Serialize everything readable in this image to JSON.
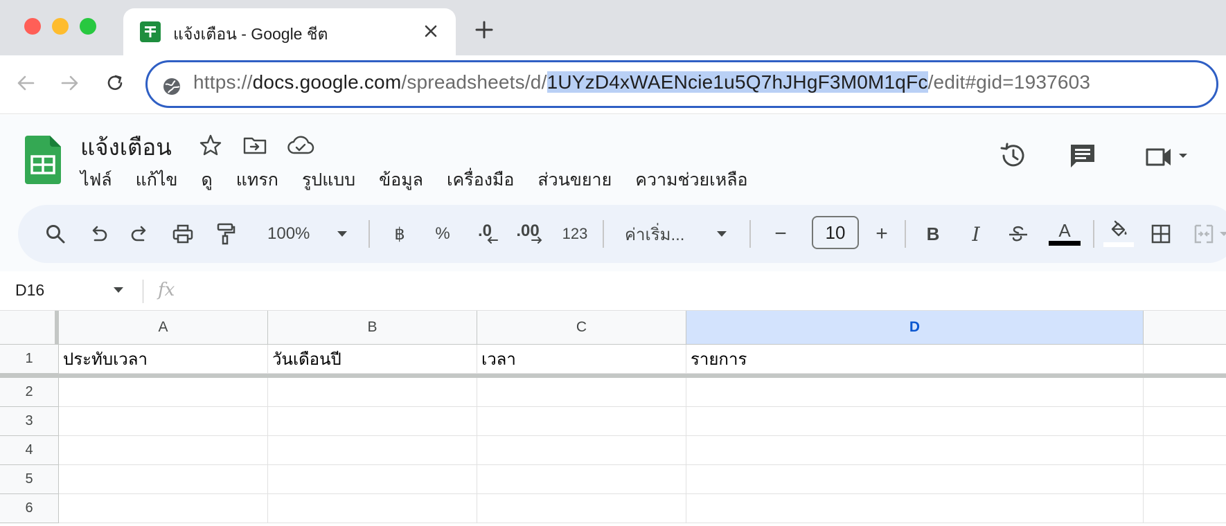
{
  "browser": {
    "tab_title": "แจ้งเตือน - Google ชีต",
    "url_scheme": "https://",
    "url_host": "docs.google.com",
    "url_path_prefix": "/spreadsheets/d/",
    "url_selected": "1UYzD4xWAENcie1u5Q7hJHgF3M0M1qFc",
    "url_path_suffix": "/edit#gid=1937603",
    "colors": {
      "traffic_red": "#ff5f57",
      "traffic_yellow": "#febc2e",
      "traffic_green": "#28c840",
      "omnibox_border": "#2f5fc4",
      "selection": "#b9d0f5"
    }
  },
  "doc": {
    "title": "แจ้งเตือน",
    "menu": [
      "ไฟล์",
      "แก้ไข",
      "ดู",
      "แทรก",
      "รูปแบบ",
      "ข้อมูล",
      "เครื่องมือ",
      "ส่วนขยาย",
      "ความช่วยเหลือ"
    ],
    "icons": {
      "star": "star-icon",
      "move": "move-to-folder-icon",
      "cloud": "cloud-saved-icon",
      "history": "history-icon",
      "comments": "comments-icon",
      "meet": "video-call-icon"
    }
  },
  "toolbar": {
    "zoom": "100%",
    "currency": "฿",
    "percent": "%",
    "decrease_decimal": ".0",
    "increase_decimal": ".00",
    "number_format": "123",
    "font": "ค่าเริ่ม...",
    "font_size": "10",
    "minus": "−",
    "plus": "+",
    "bold": "B",
    "italic": "I",
    "text_color_letter": "A",
    "text_color": "#000000",
    "fill_color": "#ffffff"
  },
  "formula_bar": {
    "cell_ref": "D16",
    "fx": "fx",
    "value": ""
  },
  "grid": {
    "columns": [
      "A",
      "B",
      "C",
      "D"
    ],
    "selected_column": "D",
    "rows": [
      {
        "num": "1",
        "cells": [
          "ประทับเวลา",
          "วันเดือนปี",
          "เวลา",
          "รายการ"
        ]
      },
      {
        "num": "2",
        "cells": [
          "",
          "",
          "",
          ""
        ]
      },
      {
        "num": "3",
        "cells": [
          "",
          "",
          "",
          ""
        ]
      },
      {
        "num": "4",
        "cells": [
          "",
          "",
          "",
          ""
        ]
      },
      {
        "num": "5",
        "cells": [
          "",
          "",
          "",
          ""
        ]
      },
      {
        "num": "6",
        "cells": [
          "",
          "",
          "",
          ""
        ]
      }
    ]
  }
}
